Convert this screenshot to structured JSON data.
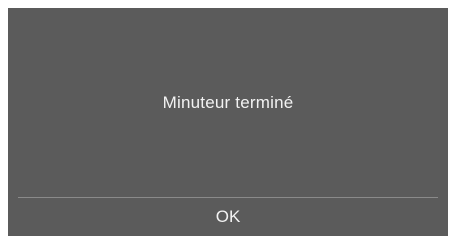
{
  "dialog": {
    "message": "Minuteur terminé",
    "ok_label": "OK",
    "background_color": "#5b5b5b",
    "text_color": "#f2f2f2",
    "divider_color": "#8a8a8a"
  }
}
